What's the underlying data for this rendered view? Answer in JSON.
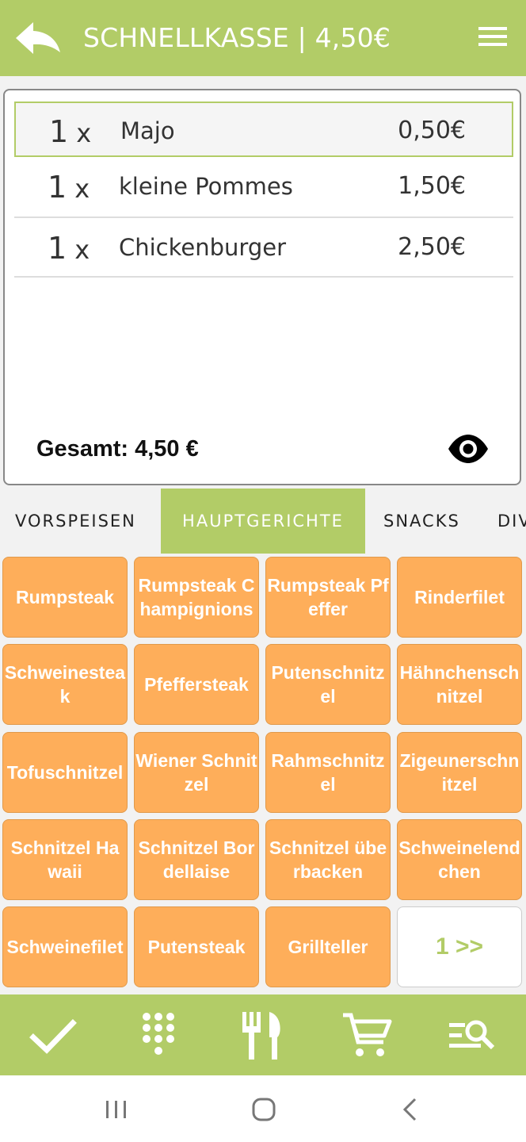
{
  "header": {
    "title": "SCHNELLKASSE | 4,50€",
    "back_icon": "back-arrow-icon",
    "menu_icon": "hamburger-menu-icon"
  },
  "order": {
    "items": [
      {
        "qty": "1",
        "x": "x",
        "name": "Majo",
        "price": "0,50€"
      },
      {
        "qty": "1",
        "x": "x",
        "name": "kleine Pommes",
        "price": "1,50€"
      },
      {
        "qty": "1",
        "x": "x",
        "name": "Chickenburger",
        "price": "2,50€"
      }
    ],
    "total": "Gesamt: 4,50 €"
  },
  "tabs": [
    {
      "label": "VORSPEISEN"
    },
    {
      "label": "HAUPTGERICHTE"
    },
    {
      "label": "SNACKS"
    },
    {
      "label": "DIV"
    }
  ],
  "products": [
    "Rumpsteak",
    "Rumpsteak Champignions",
    "Rumpsteak Pfeffer",
    "Rinderfilet",
    "Schweinesteak",
    "Pfeffersteak",
    "Putenschnitzel",
    "Hähnchenschnitzel",
    "Tofuschnitzel",
    "Wiener Schnitzel",
    "Rahmschnitzel",
    "Zigeunerschnitzel",
    "Schnitzel Hawaii",
    "Schnitzel Bordellaise",
    "Schnitzel überbacken",
    "Schweinelendchen",
    "Schweinefilet",
    "Putensteak",
    "Grillteller"
  ],
  "pager_label": "1 >>",
  "colors": {
    "accent": "#b2cc67",
    "product_button": "#feae5a"
  }
}
